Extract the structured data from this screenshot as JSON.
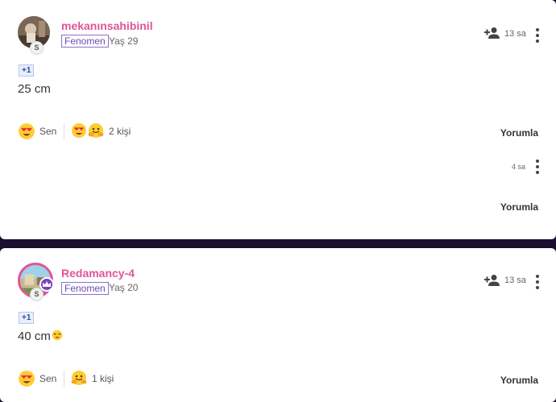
{
  "posts": [
    {
      "username": "mekanınsahibinil",
      "role": "Fenomen",
      "age": "Yaş 29",
      "time": "13 sa",
      "plus_one": "+1",
      "content": "25 cm",
      "my_reaction_label": "Sen",
      "others_count": "2 kişi",
      "comment_label": "Yorumla",
      "level_badge": "S"
    },
    {
      "time": "4 sa",
      "comment_label": "Yorumla"
    },
    {
      "username": "Redamancy-4",
      "role": "Fenomen",
      "age": "Yaş 20",
      "time": "13 sa",
      "plus_one": "+1",
      "content": "40 cm",
      "my_reaction_label": "Sen",
      "others_count": "1 kişi",
      "comment_label": "Yorumla",
      "level_badge": "S"
    }
  ],
  "colors": {
    "username": "#e0559a",
    "role_tag": "#6a4bb3",
    "page_background": "#1a0f2e"
  },
  "icons": [
    "add-user-icon",
    "more-options-icon",
    "heart-eyes-emoji",
    "hugging-emoji",
    "unamused-emoji",
    "crown-icon"
  ]
}
